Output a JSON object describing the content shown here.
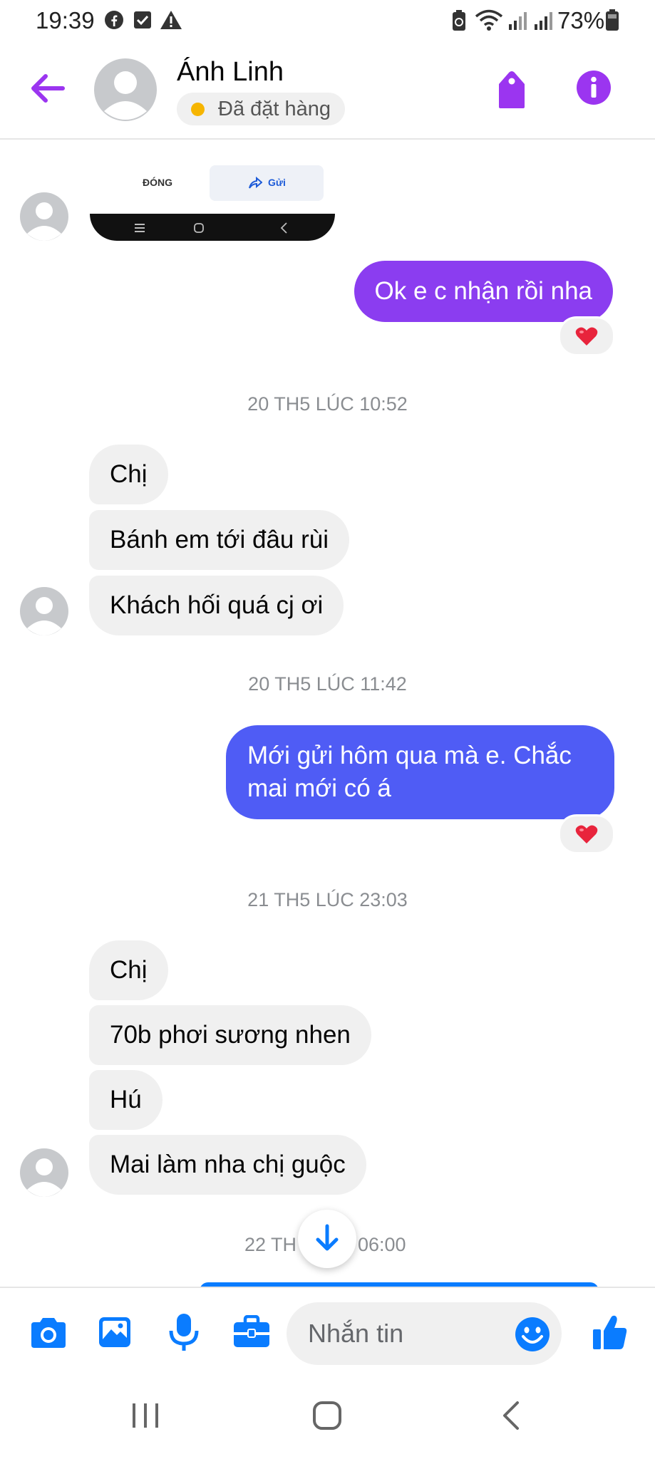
{
  "status_bar": {
    "time": "19:39",
    "battery": "73%"
  },
  "header": {
    "contact_name": "Ánh Linh",
    "order_status": "Đã đặt hàng"
  },
  "preview": {
    "close_label": "ĐÓNG",
    "send_label": "Gửi"
  },
  "messages": {
    "out1": "Ok e c nhận rồi nha",
    "ts1": "20 TH5 LÚC 10:52",
    "in1": [
      "Chị",
      "Bánh em tới đâu rùi",
      "Khách hối quá cj ơi"
    ],
    "ts2": "20 TH5 LÚC 11:42",
    "out2": "Mới gửi hôm qua mà e. Chắc mai mới có á",
    "ts3": "21 TH5 LÚC 23:03",
    "in2": [
      "Chị",
      "70b phơi sương nhen",
      "Hú",
      "Mai làm nha chị guộc"
    ],
    "ts4_left": "22 TH",
    "ts4_right": "06:00"
  },
  "composer": {
    "placeholder": "Nhắn tin"
  },
  "colors": {
    "accent_purple": "#9b35f0",
    "bubble_purple": "#8b3df0",
    "bubble_blue": "#4f5cf5",
    "messenger_blue": "#0a7cff",
    "heart_red": "#e8243c"
  },
  "icons": [
    "facebook-icon",
    "checkbox-icon",
    "warning-icon",
    "recycle-icon",
    "wifi-icon",
    "signal-icon",
    "battery-icon",
    "back-arrow-icon",
    "tag-icon",
    "info-icon",
    "heart-icon",
    "scroll-down-icon",
    "camera-icon",
    "image-icon",
    "microphone-icon",
    "briefcase-icon",
    "emoji-icon",
    "thumbs-up-icon",
    "recent-apps-icon",
    "home-icon",
    "back-nav-icon"
  ]
}
